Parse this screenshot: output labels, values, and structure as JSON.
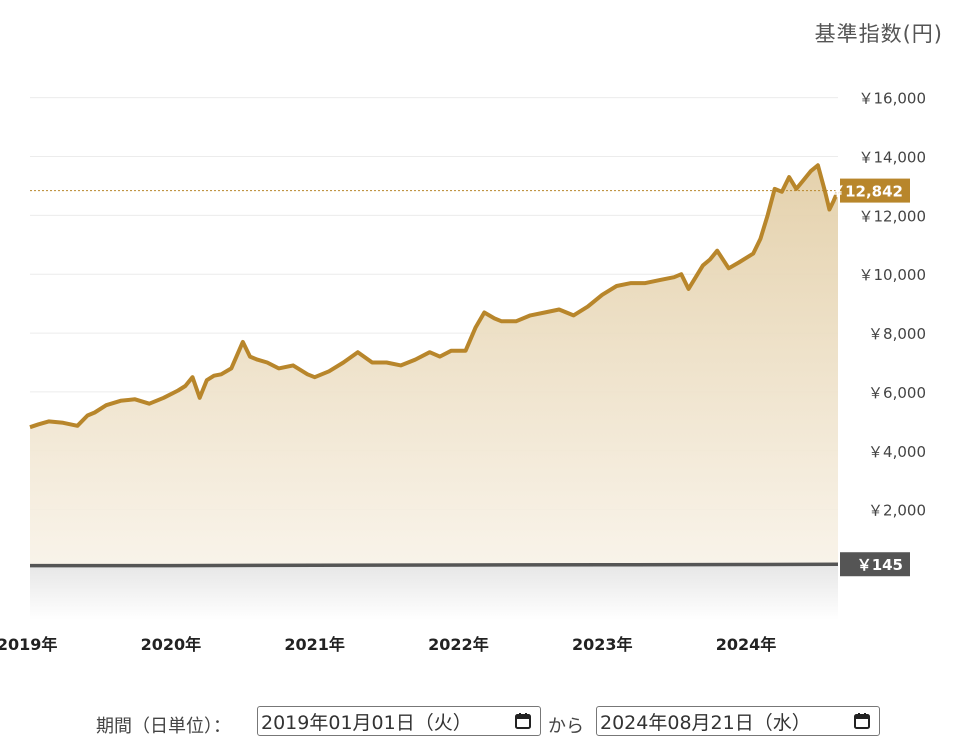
{
  "chart_data": {
    "type": "area",
    "y_axis_title": "基準指数(円)",
    "yticks": [
      2000,
      4000,
      6000,
      8000,
      10000,
      12000,
      14000,
      16000
    ],
    "ytick_labels": [
      "￥2,000",
      "￥4,000",
      "￥6,000",
      "￥8,000",
      "￥10,000",
      "￥12,000",
      "￥14,000",
      "￥16,000"
    ],
    "ylim": [
      -1750,
      16600
    ],
    "xlim": [
      2019.02,
      2024.64
    ],
    "xtick_values": [
      2019.0,
      2020.0,
      2021.0,
      2022.0,
      2023.0,
      2024.0
    ],
    "xtick_labels": [
      "2019年",
      "2020年",
      "2021年",
      "2022年",
      "2023年",
      "2024年"
    ],
    "series": [
      {
        "color": "#b8862b",
        "last_value_label": "￥12,842",
        "x": [
          2019.02,
          2019.08,
          2019.15,
          2019.25,
          2019.35,
          2019.42,
          2019.47,
          2019.55,
          2019.65,
          2019.75,
          2019.85,
          2019.95,
          2020.05,
          2020.1,
          2020.15,
          2020.2,
          2020.25,
          2020.3,
          2020.35,
          2020.42,
          2020.5,
          2020.55,
          2020.6,
          2020.67,
          2020.75,
          2020.85,
          2020.95,
          2021.0,
          2021.1,
          2021.2,
          2021.3,
          2021.4,
          2021.5,
          2021.6,
          2021.7,
          2021.8,
          2021.87,
          2021.95,
          2022.05,
          2022.12,
          2022.18,
          2022.25,
          2022.3,
          2022.4,
          2022.5,
          2022.6,
          2022.7,
          2022.8,
          2022.9,
          2023.0,
          2023.1,
          2023.2,
          2023.3,
          2023.4,
          2023.5,
          2023.55,
          2023.6,
          2023.7,
          2023.75,
          2023.8,
          2023.88,
          2023.95,
          2024.05,
          2024.1,
          2024.15,
          2024.2,
          2024.25,
          2024.3,
          2024.35,
          2024.4,
          2024.45,
          2024.5,
          2024.55,
          2024.58,
          2024.61,
          2024.64
        ],
        "values": [
          4800,
          4900,
          5000,
          4950,
          4850,
          5200,
          5300,
          5550,
          5700,
          5750,
          5600,
          5800,
          6050,
          6200,
          6500,
          5800,
          6400,
          6550,
          6600,
          6800,
          7700,
          7200,
          7100,
          7000,
          6800,
          6900,
          6600,
          6500,
          6700,
          7000,
          7350,
          7000,
          7000,
          6900,
          7100,
          7350,
          7200,
          7400,
          7400,
          8200,
          8700,
          8500,
          8400,
          8400,
          8600,
          8700,
          8800,
          8600,
          8900,
          9300,
          9600,
          9700,
          9700,
          9800,
          9900,
          10000,
          9500,
          10300,
          10500,
          10800,
          10200,
          10400,
          10700,
          11200,
          12000,
          12900,
          12800,
          13300,
          12900,
          13200,
          13500,
          13700,
          12800,
          12200,
          12500,
          12842
        ]
      },
      {
        "color": "#555555",
        "last_value_label": "￥145",
        "x": [
          2019.02,
          2020.0,
          2021.0,
          2022.0,
          2023.0,
          2024.0,
          2024.64
        ],
        "values": [
          100,
          100,
          110,
          120,
          125,
          135,
          145
        ]
      }
    ]
  },
  "date_range": {
    "label": "期間（日単位）：",
    "start": "2019年01月01日（火）",
    "separator": "から",
    "end": "2024年08月21日（水）"
  }
}
